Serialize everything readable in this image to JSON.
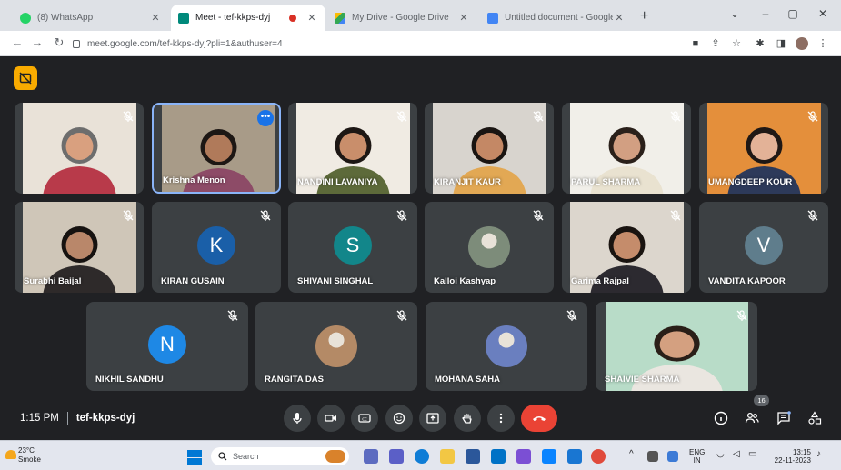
{
  "browser": {
    "tabs": [
      {
        "label": "(8) WhatsApp",
        "favicon_color": "#25d366",
        "active": false
      },
      {
        "label": "Meet - tef-kkps-dyj",
        "favicon_color": "#00897b",
        "active": true
      },
      {
        "label": "My Drive - Google Drive",
        "favicon_color": "#fbbc04",
        "active": false
      },
      {
        "label": "Untitled document - Google Do",
        "favicon_color": "#4285f4",
        "active": false
      }
    ],
    "new_tab_label": "+",
    "url": "meet.google.com/tef-kkps-dyj?pli=1&authuser=4"
  },
  "meet": {
    "time": "1:15 PM",
    "meeting_code": "tef-kkps-dyj",
    "participant_count": "16",
    "participants": [
      {
        "name": "",
        "type": "video",
        "skin": "#d9a07f",
        "bg": "#e9e2d8",
        "shirt": "#b83a4a",
        "hair": "#6d6d6d"
      },
      {
        "name": "Krishna Menon",
        "type": "video",
        "skin": "#b07a5a",
        "bg": "#a89b88",
        "shirt": "#8d4b67",
        "hair": "#1d1714",
        "active": true
      },
      {
        "name": "NANDINI LAVANIYA",
        "type": "video",
        "skin": "#c98e6b",
        "bg": "#f0ebe3",
        "shirt": "#5d6a3a",
        "hair": "#1d1714"
      },
      {
        "name": "KIRANJIT KAUR",
        "type": "video",
        "skin": "#c48865",
        "bg": "#d8d4ce",
        "shirt": "#e2a854",
        "hair": "#1a1512"
      },
      {
        "name": "PARUL SHARMA",
        "type": "video",
        "skin": "#d29f82",
        "bg": "#f1efe9",
        "shirt": "#e9e2d0",
        "hair": "#2a201a"
      },
      {
        "name": "UMANGDEEP KOUR",
        "type": "video",
        "skin": "#e3b297",
        "bg": "#e48f3b",
        "shirt": "#2d3a5a",
        "hair": "#1f1815"
      },
      {
        "name": "Surabhi Baijal",
        "type": "video",
        "skin": "#b9876a",
        "bg": "#cfc6b8",
        "shirt": "#2e2a2a",
        "hair": "#161210"
      },
      {
        "name": "KIRAN GUSAIN",
        "type": "avatar",
        "initial": "K",
        "color": "#1a5fa8"
      },
      {
        "name": "SHIVANI SINGHAL",
        "type": "avatar",
        "initial": "S",
        "color": "#12868a"
      },
      {
        "name": "Kalloi Kashyap",
        "type": "photo",
        "photo_color": "#7d8c7a"
      },
      {
        "name": "Garima Rajpal",
        "type": "video",
        "skin": "#c58c6b",
        "bg": "#dcd6cd",
        "shirt": "#2c2a30",
        "hair": "#1a1410"
      },
      {
        "name": "VANDITA KAPOOR",
        "type": "avatar",
        "initial": "V",
        "color": "#5f7d8c"
      },
      {
        "name": "NIKHIL SANDHU",
        "type": "avatar",
        "initial": "N",
        "color": "#1e88e5"
      },
      {
        "name": "RANGITA DAS",
        "type": "photo",
        "photo_color": "#b48a66"
      },
      {
        "name": "MOHANA SAHA",
        "type": "photo",
        "photo_color": "#6a7fbf"
      },
      {
        "name": "SHAIVIE SHARMA",
        "type": "video",
        "skin": "#d4a080",
        "bg": "#b8dcc8",
        "shirt": "#eae6e0",
        "hair": "#2a1f18"
      }
    ]
  },
  "taskbar": {
    "temperature": "23°C",
    "weather": "Smoke",
    "search_placeholder": "Search",
    "lang": "ENG",
    "region": "IN",
    "clock_time": "13:15",
    "clock_date": "22-11-2023"
  },
  "colors": {
    "meet_bg": "#202124",
    "tile_bg": "#3c4043",
    "end_call": "#ea4335",
    "active_border": "#8ab4f8"
  }
}
